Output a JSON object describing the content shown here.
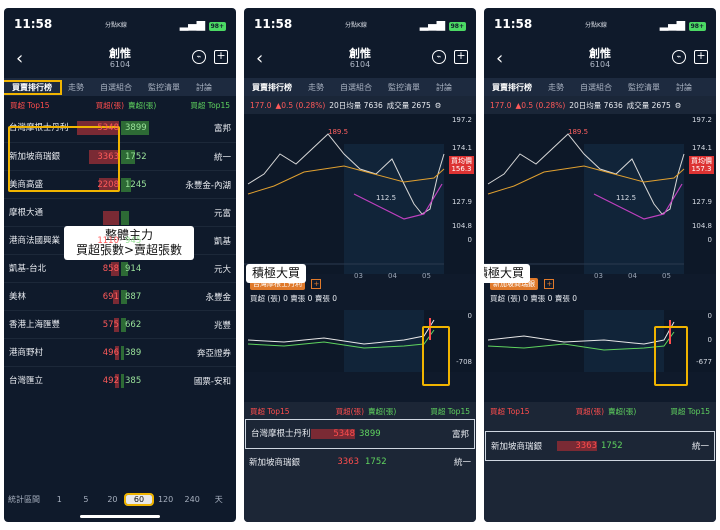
{
  "status": {
    "time": "11:58",
    "carrier": "分點K線",
    "battery": "98+"
  },
  "nav": {
    "title": "創惟",
    "code": "6104",
    "icon_back": "chevron-left-icon",
    "icon_chart": "trend-icon",
    "icon_add": "add-square-icon"
  },
  "tabs": [
    "買賣排行榜",
    "走勢",
    "自選組合",
    "監控清單",
    "討論"
  ],
  "list_header": {
    "buy_top": "買超 Top15",
    "buy_unit": "買超(張)",
    "sell_unit": "賣超(張)",
    "sell_top": "買超 Top15"
  },
  "rows": [
    {
      "name": "台灣摩根士丹利",
      "buy": "5348",
      "sell": "3899",
      "broker": "富邦",
      "bw": 42,
      "sw": 28
    },
    {
      "name": "新加坡商瑞銀",
      "buy": "3363",
      "sell": "1752",
      "broker": "統一",
      "bw": 30,
      "sw": 14
    },
    {
      "name": "美商高盛",
      "buy": "2208",
      "sell": "1245",
      "broker": "永豐金-內湖",
      "bw": 20,
      "sw": 10
    },
    {
      "name": "摩根大通",
      "buy": "",
      "sell": "",
      "broker": "元富",
      "bw": 16,
      "sw": 8
    },
    {
      "name": "港商法國興業",
      "buy": "1110",
      "sell": "945",
      "broker": "凱基",
      "bw": 10,
      "sw": 7
    },
    {
      "name": "凱基-台北",
      "buy": "858",
      "sell": "914",
      "broker": "元大",
      "bw": 8,
      "sw": 7
    },
    {
      "name": "美林",
      "buy": "691",
      "sell": "887",
      "broker": "永豐金",
      "bw": 6,
      "sw": 6
    },
    {
      "name": "香港上海匯豐",
      "buy": "575",
      "sell": "662",
      "broker": "兆豐",
      "bw": 5,
      "sw": 5
    },
    {
      "name": "港商野村",
      "buy": "496",
      "sell": "389",
      "broker": "奔亞證券",
      "bw": 4,
      "sw": 3
    },
    {
      "name": "台灣匯立",
      "buy": "492",
      "sell": "385",
      "broker": "國票-安和",
      "bw": 4,
      "sw": 3
    }
  ],
  "footer": {
    "label": "統計區間",
    "options": [
      "1",
      "5",
      "20",
      "60",
      "120",
      "240",
      "天"
    ],
    "selected": "60"
  },
  "annotations": {
    "note1": "整體主力\n買超張數>賣超張數",
    "note2": "積極大買",
    "note3": "積極大買"
  },
  "price_bar": {
    "price": "177.0",
    "change": "▲0.5 (0.28%)",
    "ma": "20日均量 7636",
    "volume": "成交量 2675"
  },
  "chart_axis": {
    "y": [
      "197.2",
      "174.1",
      "151",
      "127.9",
      "104.8",
      "0"
    ],
    "months": [
      "03",
      "04",
      "05"
    ],
    "peak": "189.5",
    "low": "112.5",
    "avg_label": "買均價",
    "avg_p2": "156.3",
    "avg_p3": "157.3"
  },
  "sub_p2": {
    "broker": "台灣摩根士丹利",
    "stats": "買超 (張) 0 賣張 0 賣張 0"
  },
  "sub_p3": {
    "broker": "新加坡商瑞銀",
    "stats": "買超 (張) 0 賣張 0 賣張 0"
  },
  "indi_axis": {
    "p2_top": "0",
    "p2_bottom": "-708",
    "p3_top": "0",
    "p3_mid": "0",
    "p3_bottom": "-677"
  },
  "colors": {
    "bg": "#0f1a2b",
    "highlight": "#f0b400",
    "up": "#ff4d4d",
    "down": "#5fd35f"
  }
}
